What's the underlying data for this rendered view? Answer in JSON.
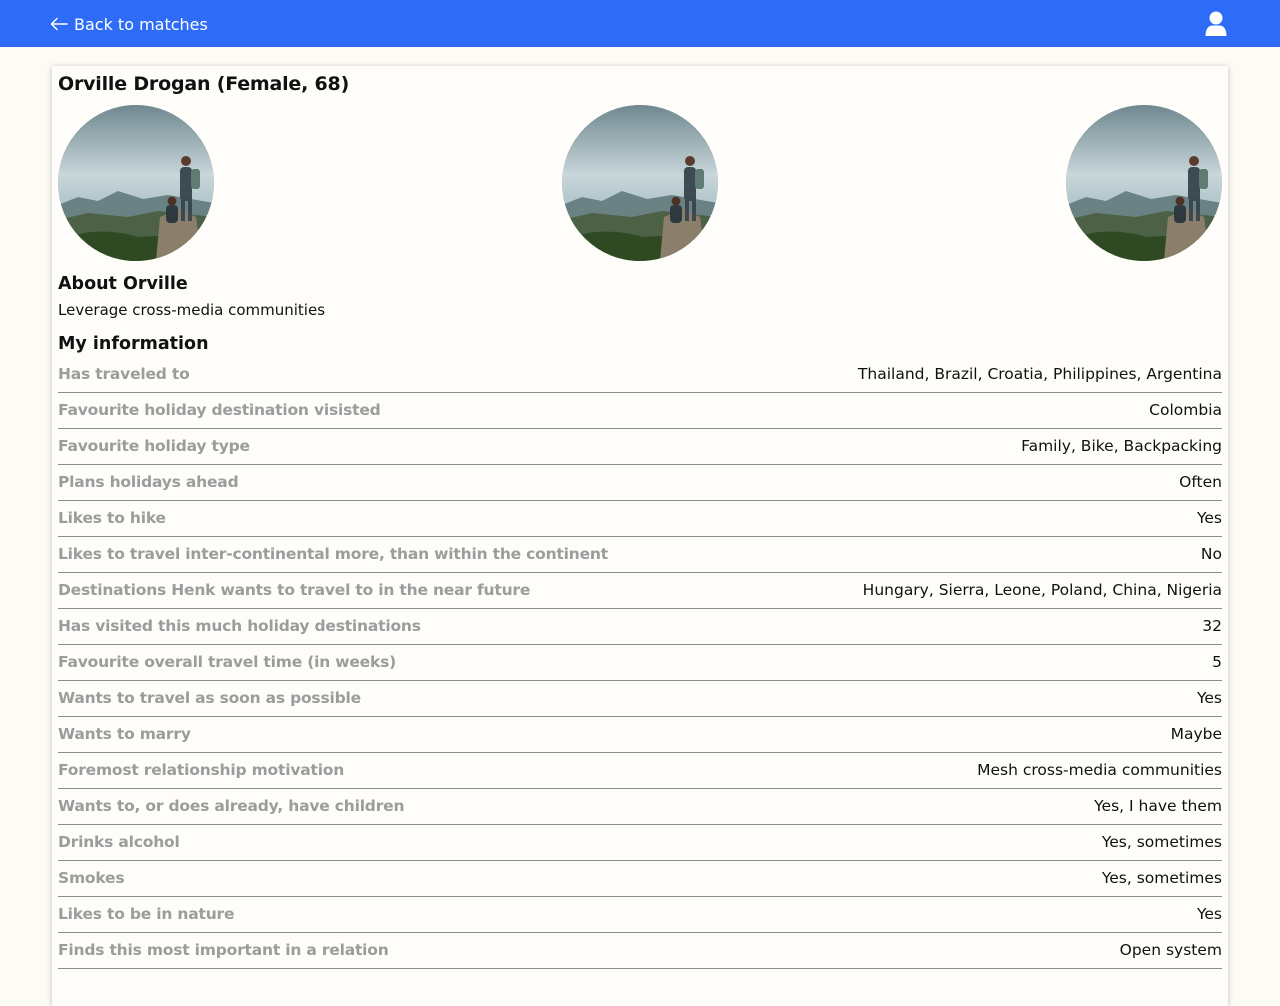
{
  "header": {
    "back_label": "Back to matches",
    "icons": {
      "back": "arrow-left-icon",
      "user": "user-icon"
    },
    "background": "#2e6bf6"
  },
  "profile": {
    "title": "Orville Drogan (Female, 68)",
    "photos": [
      "profile-photo",
      "profile-photo",
      "profile-photo"
    ],
    "about_title": "About Orville",
    "about_text": "Leverage cross-media communities",
    "info_title": "My information",
    "info": [
      {
        "label": "Has traveled to",
        "value": "Thailand, Brazil, Croatia, Philippines, Argentina"
      },
      {
        "label": "Favourite holiday destination visisted",
        "value": "Colombia"
      },
      {
        "label": "Favourite holiday type",
        "value": "Family, Bike, Backpacking"
      },
      {
        "label": "Plans holidays ahead",
        "value": "Often"
      },
      {
        "label": "Likes to hike",
        "value": "Yes"
      },
      {
        "label": "Likes to travel inter-continental more, than within the continent",
        "value": "No"
      },
      {
        "label": "Destinations Henk wants to travel to in the near future",
        "value": "Hungary, Sierra, Leone, Poland, China, Nigeria"
      },
      {
        "label": "Has visited this much holiday destinations",
        "value": "32"
      },
      {
        "label": "Favourite overall travel time (in weeks)",
        "value": "5"
      },
      {
        "label": "Wants to travel as soon as possible",
        "value": "Yes"
      },
      {
        "label": "Wants to marry",
        "value": "Maybe"
      },
      {
        "label": "Foremost relationship motivation",
        "value": "Mesh cross-media communities"
      },
      {
        "label": "Wants to, or does already, have children",
        "value": "Yes, I have them"
      },
      {
        "label": "Drinks alcohol",
        "value": "Yes, sometimes"
      },
      {
        "label": "Smokes",
        "value": "Yes, sometimes"
      },
      {
        "label": "Likes to be in nature",
        "value": "Yes"
      },
      {
        "label": "Finds this most important in a relation",
        "value": "Open system"
      }
    ]
  }
}
